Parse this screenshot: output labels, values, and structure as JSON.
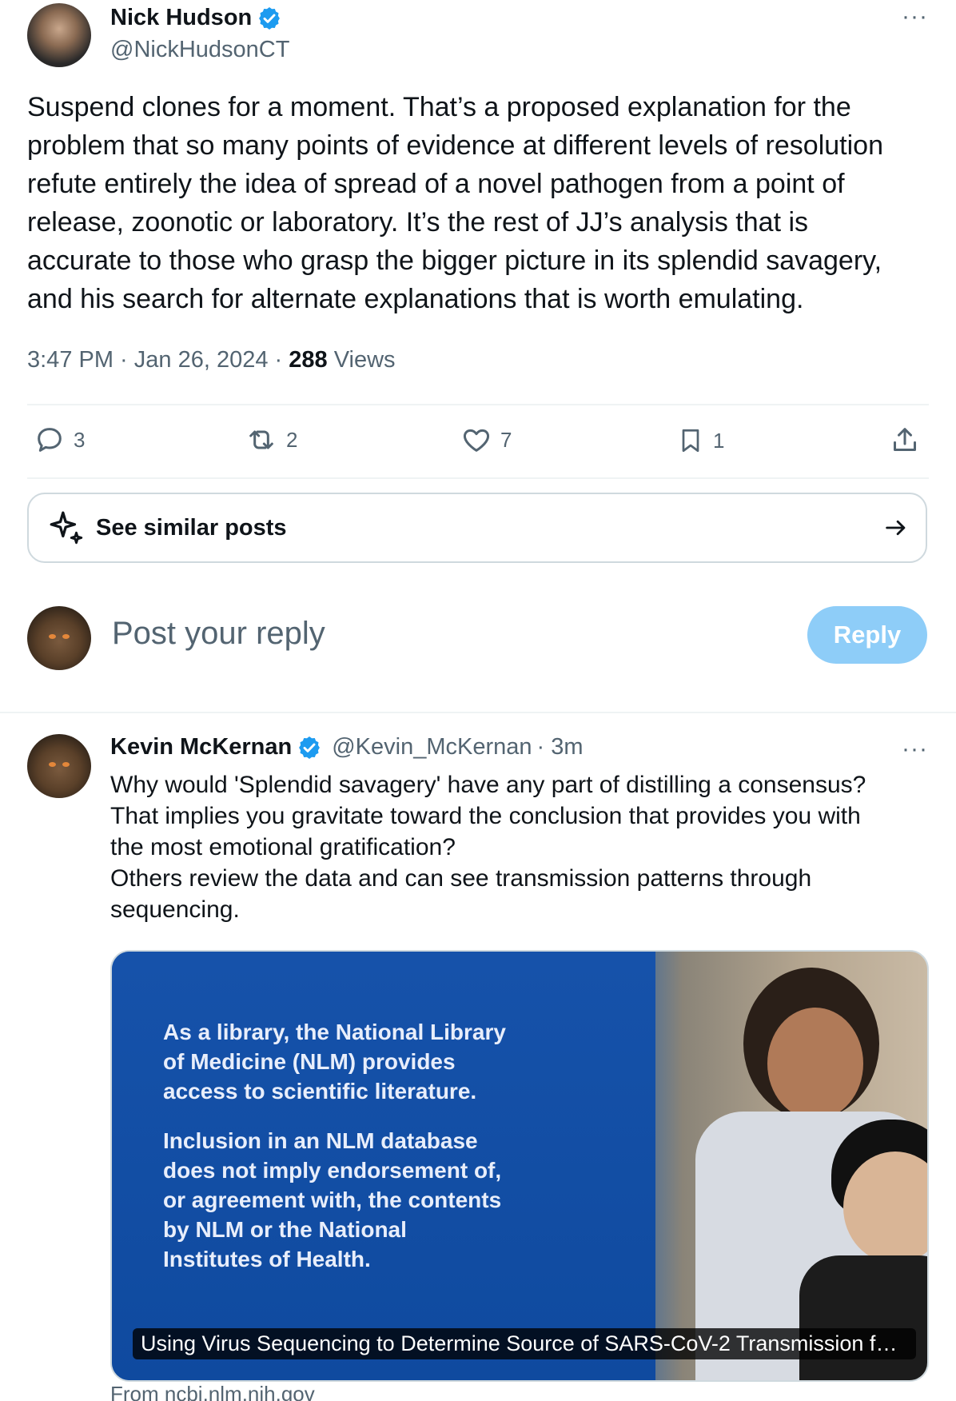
{
  "tweet": {
    "author_name": "Nick Hudson",
    "author_handle": "@NickHudsonCT",
    "more_label": "···",
    "text": "Suspend clones for a moment. That’s a proposed explanation for the\nproblem that so many points of evidence at different levels of resolution\nrefute entirely the idea of spread of a novel pathogen from a point of\nrelease, zoonotic or laboratory. It’s the rest of JJ’s analysis that is\naccurate to those who grasp the bigger picture in its splendid savagery,\nand his search for alternate explanations that is worth emulating.",
    "time": "3:47 PM · Jan 26, 2024 · ",
    "views_count": "288",
    "views_label": " Views",
    "actions": {
      "replies": "3",
      "reposts": "2",
      "likes": "7",
      "bookmarks": "1"
    }
  },
  "similar": {
    "label": "See similar posts"
  },
  "reply_box": {
    "placeholder": "Post your reply",
    "button": "Reply"
  },
  "reply": {
    "author_name": "Kevin McKernan",
    "author_handle": "@Kevin_McKernan",
    "time": " · 3m",
    "more_label": "···",
    "text": "Why would 'Splendid savagery' have any part of distilling a consensus?\nThat implies you gravitate toward the conclusion that provides you with\nthe most emotional gratification?\nOthers review the data and can see transmission patterns through\nsequencing.",
    "card": {
      "text_1": "As a library, the National Library\nof Medicine (NLM) provides\naccess to scientific literature.",
      "text_2": "Inclusion in an NLM database\ndoes not imply endorsement of,\nor agreement with, the contents\nby NLM or the National\nInstitutes of Health.",
      "caption": "Using Virus Sequencing to Determine Source of SARS-CoV-2 Transmission for ...",
      "source": "From ncbi.nlm.nih.gov"
    }
  },
  "colors": {
    "verified_blue": "#1d9bf0",
    "secondary_text": "#536471",
    "reply_button": "#8ecdf8"
  },
  "icons": [
    "verified-badge-icon",
    "more-icon",
    "reply-icon",
    "repost-icon",
    "like-icon",
    "bookmark-icon",
    "share-icon",
    "sparkle-icon",
    "arrow-right-icon"
  ]
}
